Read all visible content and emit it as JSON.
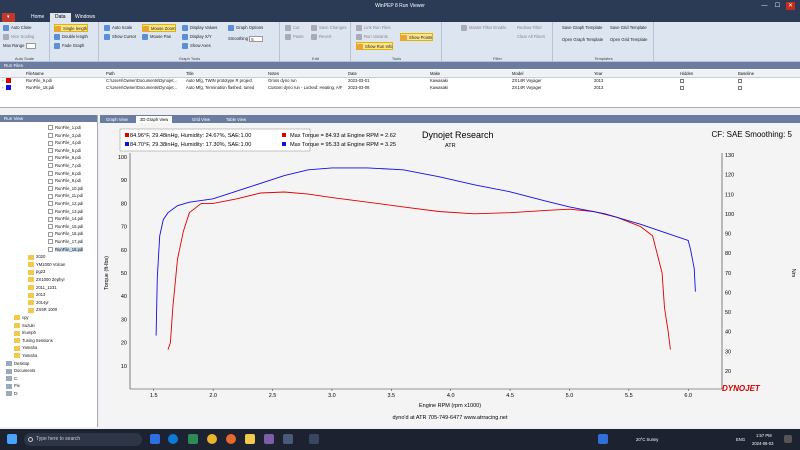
{
  "window": {
    "title": "WinPEP 8 Run Viewer",
    "min": "—",
    "max": "☐",
    "close": "✕"
  },
  "ribbon_tabs": [
    "Home",
    "Data",
    "Windows"
  ],
  "ribbon_active_tab": 1,
  "ribbon": {
    "auto_scale_group": {
      "label": "Auto Scale",
      "buttons": [
        "Auto Close",
        "Nice Scaling",
        "Max Range"
      ]
    },
    "graph_length_group": {
      "buttons": [
        "Single length",
        "Double length",
        "Fade Graph"
      ]
    },
    "zoom_group": {
      "label": "Graph Tools",
      "buttons": [
        "Auto Scale",
        "Mouse Zoom",
        "Display Values",
        "Show Cursor",
        "Mouse Pan",
        "Display X/Y",
        "Show Axes",
        "Graph Options",
        "Smoothing"
      ],
      "smoothing_value": "5"
    },
    "edit_group": {
      "label": "Edit",
      "buttons": [
        "Cut",
        "Paste",
        "Save Changes",
        "Revert"
      ]
    },
    "tools_group": {
      "label": "Tools",
      "buttons": [
        "Link Run Files",
        "Run Variants",
        "Show Points",
        "Show Run Info"
      ]
    },
    "filter_group": {
      "label": "Filter",
      "buttons": [
        "Master Filter Enable",
        "Redraw Filter",
        "Clear All Filters"
      ]
    },
    "templates_group": {
      "label": "Templates",
      "buttons": [
        "Save Graph Template",
        "Save Grid Template",
        "Open Graph Template",
        "Open Grid Template"
      ]
    }
  },
  "run_grid": {
    "header": "Run Files",
    "columns": [
      "",
      "FileName",
      "Path",
      "Title",
      "Notes",
      "Date",
      "Make",
      "Model",
      "Year",
      "Hidden",
      "Baseline"
    ],
    "rows": [
      {
        "color": "#e00000",
        "filename": "RunFile_9.pdi",
        "path": "C:\\Users\\Owner\\Documents\\Dynojet...",
        "title": "Auto Mfg, TWIN prototype R project",
        "notes": "Gross dyno run",
        "date": "2023-03-01",
        "make": "Kawasaki",
        "model": "ZX14R Voyager",
        "year": "2013"
      },
      {
        "color": "#1010e0",
        "filename": "RunFile_18.pdi",
        "path": "C:\\Users\\Owner\\Documents\\Dynojet...",
        "title": "Auto Mfg, Termination flashed, tuned",
        "notes": "Custom dyno run - Locked: Heating, A/F",
        "date": "2023-03-08",
        "make": "Kawasaki",
        "model": "ZX14R Voyager",
        "year": "2013"
      }
    ]
  },
  "tree": {
    "header": "Run View",
    "files": [
      "RunFile_1.pdi",
      "RunFile_3.pdi",
      "RunFile_4.pdi",
      "RunFile_5.pdi",
      "RunFile_6.pdi",
      "RunFile_7.pdi",
      "RunFile_8.pdi",
      "RunFile_9.pdi",
      "RunFile_10.pdi",
      "RunFile_11.pdi",
      "RunFile_12.pdi",
      "RunFile_13.pdi",
      "RunFile_14.pdi",
      "RunFile_15.pdi",
      "RunFile_16.pdi",
      "RunFile_17.pdi",
      "RunFile_18.pdi"
    ],
    "folders": [
      "2020",
      "YM1000 Volcan",
      "pg23",
      "ZX1000 Zephyr",
      "2011_1231",
      "2013",
      "2014yr",
      "ZX6R 1000"
    ],
    "other_folders": [
      "cpy",
      "Suzuki",
      "triumph",
      "Tuning Sessions",
      "Yamaha",
      "Yamaha"
    ],
    "drives": [
      "Desktop",
      "Documents",
      "C:",
      "Pix",
      "D:"
    ]
  },
  "graph_tabs": [
    "Graph View",
    "3D Graph View",
    "Grid View",
    "Table View"
  ],
  "graph": {
    "info_lines": [
      "84.96°F, 29.48inHg, Humidity: 24.67%, SAE:1.00",
      "84.70°F, 29.38inHg, Humidity: 17.30%, SAE:1.00"
    ],
    "max_lines": [
      "Max Torque = 84.93 at Engine RPM = 2.62",
      "Max Torque = 95.33 at Engine RPM = 3.25"
    ],
    "header_title": "Dynojet Research",
    "header_sub": "ATR",
    "cf_label": "CF: SAE Smoothing: 5",
    "footer_line1": "dyno'd at ATR   705-749-6477   www.atrracing.net",
    "logo": "DYNOJET"
  },
  "chart_data": {
    "type": "line",
    "xlabel": "Engine RPM (rpm x1000)",
    "ylabel": "Torque (ft-lbs)",
    "y2label": "Nm",
    "xlim": [
      1.3,
      6.2
    ],
    "ylim": [
      0,
      100
    ],
    "x_ticks": [
      "1.5",
      "2.0",
      "2.5",
      "3.0",
      "3.5",
      "4.0",
      "4.5",
      "5.0",
      "5.5",
      "6.0"
    ],
    "y_ticks": [
      "10",
      "20",
      "30",
      "40",
      "50",
      "60",
      "70",
      "80",
      "90",
      "100"
    ],
    "y2_ticks": [
      "20",
      "30",
      "40",
      "50",
      "60",
      "70",
      "80",
      "90",
      "100",
      "110",
      "120",
      "130"
    ],
    "grid": false,
    "series": [
      {
        "color": "#e00000",
        "x": [
          1.62,
          1.64,
          1.66,
          1.7,
          1.75,
          1.8,
          1.9,
          2.0,
          2.2,
          2.4,
          2.6,
          2.8,
          3.0,
          3.3,
          3.6,
          3.9,
          4.2,
          4.5,
          4.8,
          5.0,
          5.2,
          5.4,
          5.6,
          5.7,
          5.78,
          5.8,
          5.83,
          5.85
        ],
        "y": [
          17,
          20,
          35,
          56,
          68,
          76,
          80,
          80,
          82,
          84.5,
          84.9,
          84,
          82.5,
          80.5,
          78.5,
          76.5,
          75.5,
          76,
          77,
          77.5,
          76.5,
          74,
          70,
          66,
          50,
          35,
          25,
          17
        ]
      },
      {
        "color": "#1010e0",
        "x": [
          1.52,
          1.53,
          1.55,
          1.58,
          1.62,
          1.7,
          1.8,
          2.0,
          2.3,
          2.6,
          2.8,
          3.0,
          3.3,
          3.6,
          3.9,
          4.2,
          4.5,
          4.8,
          5.0,
          5.3,
          5.6,
          5.8,
          6.0,
          6.02,
          6.05,
          6.06
        ],
        "y": [
          23,
          48,
          66,
          73,
          76,
          79,
          80.5,
          82,
          87,
          92,
          94.5,
          95.3,
          95.3,
          94.5,
          91.5,
          88,
          85,
          81,
          78.5,
          75.5,
          71,
          67.5,
          64,
          60,
          52,
          42
        ]
      }
    ]
  },
  "taskbar": {
    "search_placeholder": "Type here to search",
    "weather": "20°C Sunny",
    "lang": "ENG",
    "time": "1:57 PM",
    "date": "2024-06-03"
  }
}
